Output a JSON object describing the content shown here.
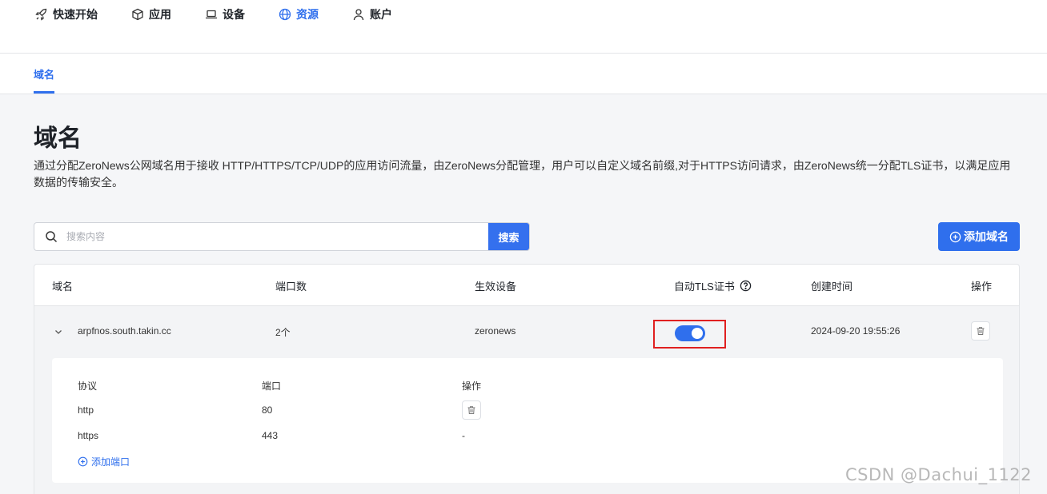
{
  "nav": {
    "items": [
      {
        "label": "快速开始",
        "icon": "rocket-icon"
      },
      {
        "label": "应用",
        "icon": "cube-icon"
      },
      {
        "label": "设备",
        "icon": "laptop-icon"
      },
      {
        "label": "资源",
        "icon": "globe-icon",
        "active": true
      },
      {
        "label": "账户",
        "icon": "user-icon"
      }
    ],
    "active_color": "#2f6fed"
  },
  "subnav": {
    "tab": "域名"
  },
  "page": {
    "title": "域名",
    "description": "通过分配ZeroNews公网域名用于接收 HTTP/HTTPS/TCP/UDP的应用访问流量，由ZeroNews分配管理，用户可以自定义域名前缀,对于HTTPS访问请求，由ZeroNews统一分配TLS证书，以满足应用数据的传输安全。"
  },
  "search": {
    "placeholder": "搜索内容",
    "value": "",
    "button": "搜索"
  },
  "add_button": "添加域名",
  "table": {
    "columns": [
      "域名",
      "端口数",
      "生效设备",
      "自动TLS证书",
      "创建时间",
      "操作"
    ],
    "rows": [
      {
        "domain": "arpfnos.south.takin.cc",
        "ports": "2个",
        "device": "zeronews",
        "auto_tls": true,
        "created": "2024-09-20 19:55:26",
        "expanded": true,
        "sub_columns": [
          "协议",
          "端口",
          "操作"
        ],
        "sub_rows": [
          {
            "protocol": "http",
            "port": "80",
            "action": "delete"
          },
          {
            "protocol": "https",
            "port": "443",
            "action": "-"
          }
        ],
        "add_port": "添加端口"
      }
    ]
  },
  "watermark": "CSDN @Dachui_1122"
}
